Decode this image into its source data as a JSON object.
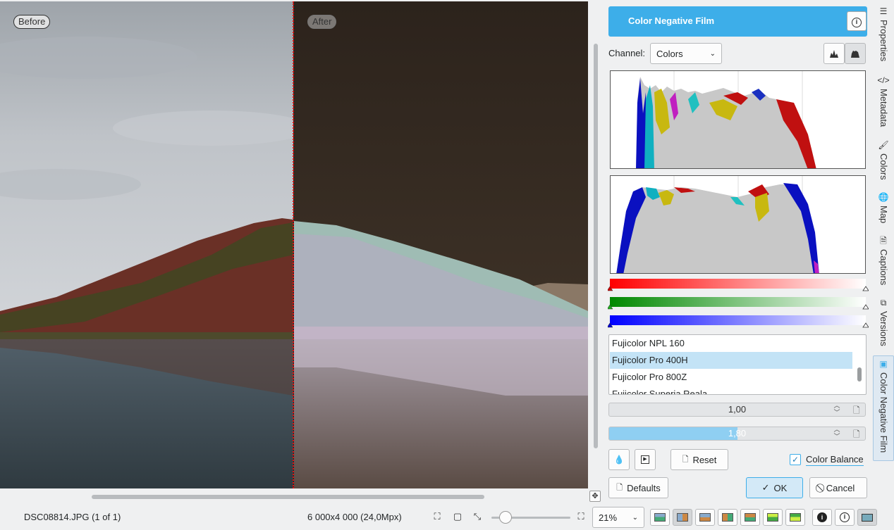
{
  "preview": {
    "before_label": "Before",
    "after_label": "After"
  },
  "tool": {
    "title": "Color Negative Film",
    "info_icon": "info-icon",
    "channel_label": "Channel:",
    "channel_value": "Colors",
    "histogram_linear_icon": "histogram-linear-icon",
    "histogram_log_icon": "histogram-log-icon",
    "accent_color": "#3daee9"
  },
  "film_list": {
    "items": [
      "Fujicolor NPL 160",
      "Fujicolor Pro 400H",
      "Fujicolor Pro 800Z",
      "Fujicolor Superia Reala"
    ],
    "selected_index": 1
  },
  "sliders": [
    {
      "value": "1,00",
      "fill": 0.0
    },
    {
      "value": "1,80",
      "fill": 0.5
    }
  ],
  "buttons": {
    "reset": "Reset",
    "color_balance": "Color Balance",
    "color_balance_checked": true,
    "defaults": "Defaults",
    "ok": "OK",
    "cancel": "Cancel"
  },
  "side_tabs": [
    {
      "label": "Properties",
      "icon": "properties-icon"
    },
    {
      "label": "Metadata",
      "icon": "metadata-icon"
    },
    {
      "label": "Colors",
      "icon": "colors-icon"
    },
    {
      "label": "Map",
      "icon": "map-icon"
    },
    {
      "label": "Captions",
      "icon": "captions-icon"
    },
    {
      "label": "Versions",
      "icon": "versions-icon"
    },
    {
      "label": "Color Negative Film",
      "icon": "color-negative-film-icon"
    }
  ],
  "status": {
    "filename": "DSC08814.JPG (1 of 1)",
    "dimensions": "6 000x4 000 (24,0Mpx)",
    "zoom": "21%",
    "zoom_slider_level": 0.18
  }
}
